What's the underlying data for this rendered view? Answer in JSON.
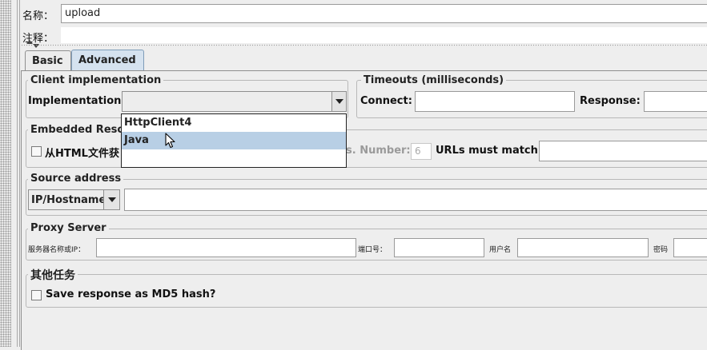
{
  "name_label": "名称：",
  "name_value": "upload",
  "comment_label": "注释：",
  "tabs": [
    {
      "label": "Basic",
      "active": false
    },
    {
      "label": "Advanced",
      "active": true
    }
  ],
  "client_impl": {
    "title": "Client implementation",
    "label": "Implementation:",
    "value": "",
    "options": [
      "HttpClient4",
      "Java"
    ],
    "highlighted_option": "Java"
  },
  "timeouts": {
    "title": "Timeouts (milliseconds)",
    "connect_label": "Connect:",
    "connect_value": "",
    "response_label": "Response:",
    "response_value": ""
  },
  "embedded": {
    "title_visible": "Embedded Reso",
    "checkbox_label_visible": "从HTML文件获",
    "number_label_visible": "s. Number:",
    "number_value": "6",
    "urls_label": "URLs must match:",
    "urls_value": ""
  },
  "source_address": {
    "title": "Source address",
    "type_value": "IP/Hostname",
    "address_value": ""
  },
  "proxy": {
    "title": "Proxy Server",
    "host_label": "服务器名称或IP：",
    "port_label": "端口号：",
    "user_label": "用户名",
    "password_label": "密码"
  },
  "other_tasks": {
    "title": "其他任务",
    "md5_label": "Save response as MD5 hash?"
  },
  "colors": {
    "background": "#eeeeee",
    "tab_active": "#d5e2ef",
    "dropdown_highlight": "#b8cfe5"
  }
}
